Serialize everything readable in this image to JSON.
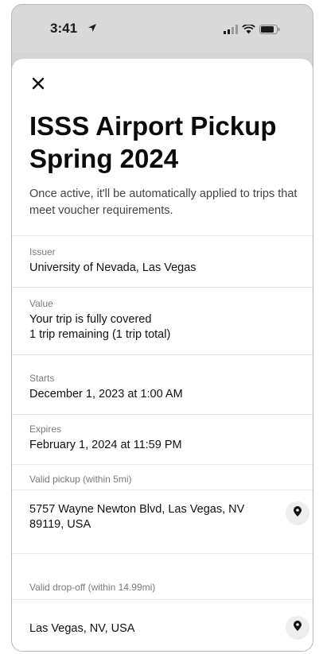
{
  "status_bar": {
    "time": "3:41"
  },
  "voucher": {
    "title_line1": "ISSS Airport Pickup",
    "title_line2": "Spring 2024",
    "description": "Once active, it'll be automatically applied to trips that meet voucher requirements."
  },
  "fields": {
    "issuer": {
      "label": "Issuer",
      "value": "University of Nevada, Las Vegas"
    },
    "value": {
      "label": "Value",
      "line1": "Your trip is fully covered",
      "line2": "1 trip remaining (1 trip total)"
    },
    "starts": {
      "label": "Starts",
      "value": "December 1, 2023 at 1:00 AM"
    },
    "expires": {
      "label": "Expires",
      "value": "February 1, 2024 at 11:59 PM"
    },
    "pickup": {
      "label": "Valid pickup (within 5mi)",
      "line1": "5757 Wayne Newton Blvd, Las Vegas, NV",
      "line2": "89119, USA"
    },
    "dropoff": {
      "label": "Valid drop-off (within 14.99mi)",
      "value": "Las Vegas, NV, USA"
    }
  }
}
